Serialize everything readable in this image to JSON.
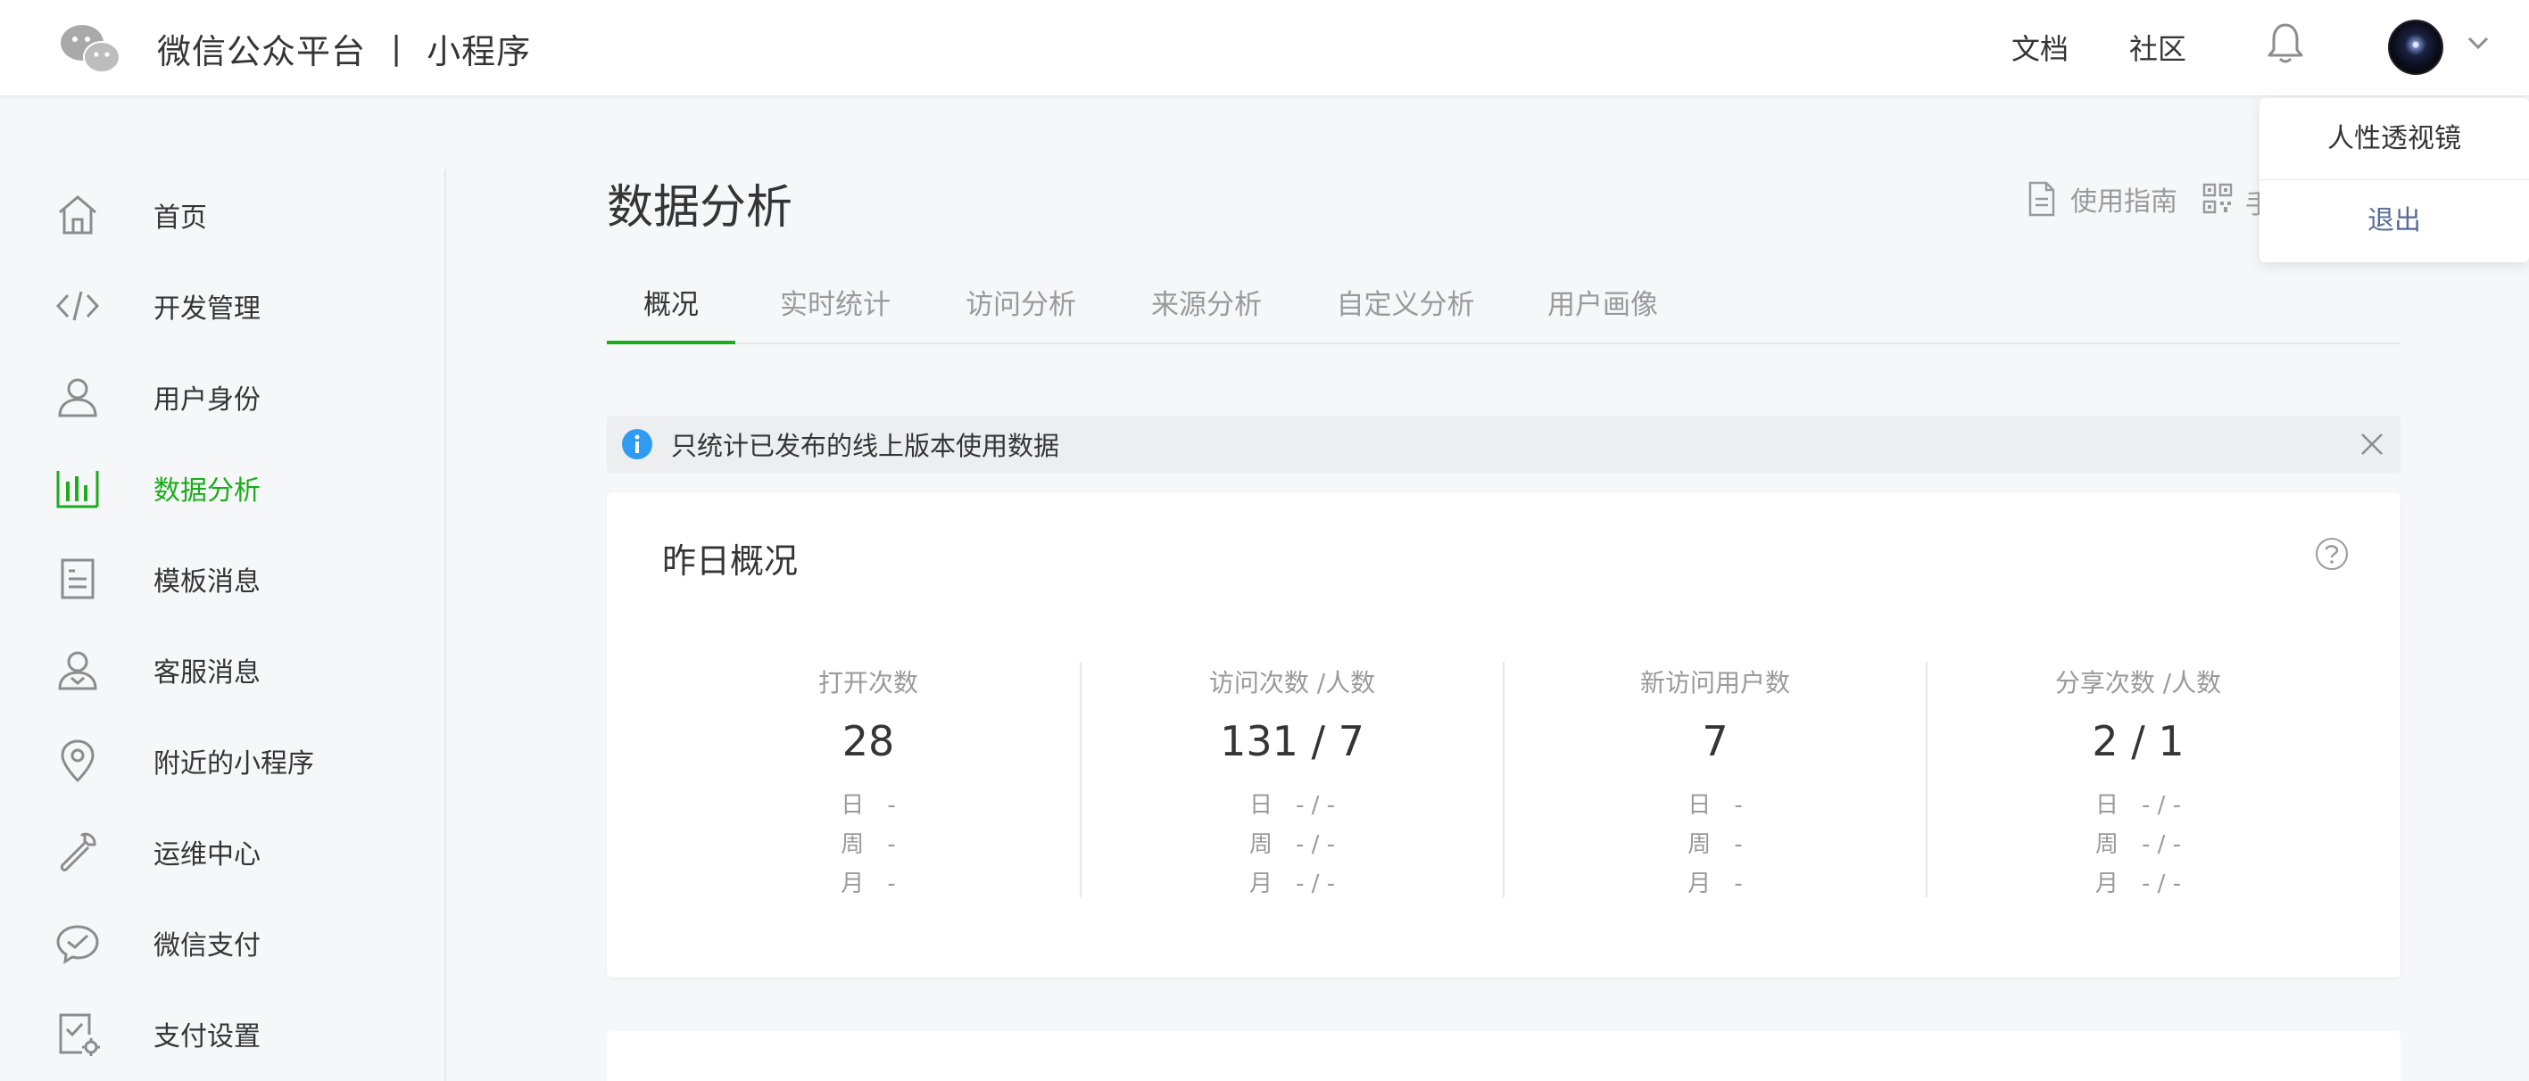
{
  "header": {
    "brand_name": "微信公众平台",
    "separator": "|",
    "brand_sub": "小程序",
    "links": {
      "docs": "文档",
      "community": "社区"
    }
  },
  "account_menu": {
    "name": "人性透视镜",
    "logout": "退出"
  },
  "sidebar": {
    "items": [
      {
        "label": "首页",
        "icon": "home-icon"
      },
      {
        "label": "开发管理",
        "icon": "code-icon"
      },
      {
        "label": "用户身份",
        "icon": "user-icon"
      },
      {
        "label": "数据分析",
        "icon": "chart-icon",
        "active": true
      },
      {
        "label": "模板消息",
        "icon": "template-icon"
      },
      {
        "label": "客服消息",
        "icon": "customer-service-icon"
      },
      {
        "label": "附近的小程序",
        "icon": "location-icon"
      },
      {
        "label": "运维中心",
        "icon": "wrench-icon"
      },
      {
        "label": "微信支付",
        "icon": "wechat-pay-icon"
      },
      {
        "label": "支付设置",
        "icon": "payment-settings-icon"
      }
    ]
  },
  "main": {
    "title": "数据分析",
    "guide_label": "使用指南",
    "tabs": [
      {
        "label": "概况",
        "active": true
      },
      {
        "label": "实时统计"
      },
      {
        "label": "访问分析"
      },
      {
        "label": "来源分析"
      },
      {
        "label": "自定义分析"
      },
      {
        "label": "用户画像"
      }
    ],
    "notice": "只统计已发布的线上版本使用数据",
    "overview": {
      "title": "昨日概况",
      "stats": [
        {
          "label": "打开次数",
          "value": "28",
          "day_key": "日",
          "day": "-",
          "week_key": "周",
          "week": "-",
          "month_key": "月",
          "month": "-"
        },
        {
          "label": "访问次数 /人数",
          "value": "131 / 7",
          "day_key": "日",
          "day": "- / -",
          "week_key": "周",
          "week": "- / -",
          "month_key": "月",
          "month": "- / -"
        },
        {
          "label": "新访问用户数",
          "value": "7",
          "day_key": "日",
          "day": "-",
          "week_key": "周",
          "week": "-",
          "month_key": "月",
          "month": "-"
        },
        {
          "label": "分享次数 /人数",
          "value": "2 / 1",
          "day_key": "日",
          "day": "- / -",
          "week_key": "周",
          "week": "- / -",
          "month_key": "月",
          "month": "- / -"
        }
      ]
    }
  },
  "colors": {
    "accent_green": "#1aad19",
    "link_blue": "#576b95",
    "info_blue": "#2f9bf3",
    "muted_text": "#9a9a9a",
    "text": "#353535"
  }
}
